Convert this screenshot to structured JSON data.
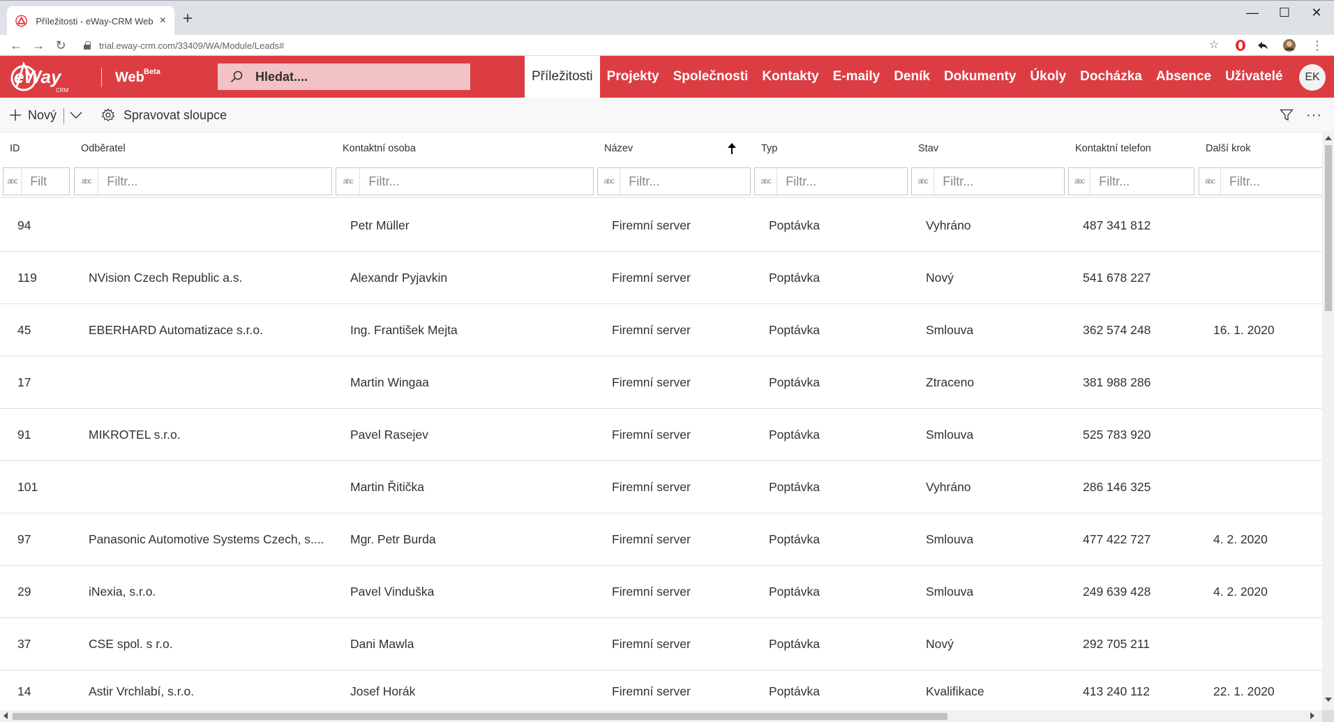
{
  "browser": {
    "tab_title": "Příležitosti - eWay-CRM Web Access",
    "tab_close": "×",
    "new_tab": "+",
    "url": "trial.eway-crm.com/33409/WA/Module/Leads#",
    "minimize": "—",
    "maximize": "☐",
    "close": "✕"
  },
  "header": {
    "logo_text": "eWay",
    "logo_sub": "CRM",
    "web_label": "Web",
    "web_beta": "Beta",
    "search_placeholder": "Hledat....",
    "nav": [
      {
        "label": "Příležitosti",
        "active": true
      },
      {
        "label": "Projekty"
      },
      {
        "label": "Společnosti"
      },
      {
        "label": "Kontakty"
      },
      {
        "label": "E-maily"
      },
      {
        "label": "Deník"
      },
      {
        "label": "Dokumenty"
      },
      {
        "label": "Úkoly"
      },
      {
        "label": "Docházka"
      },
      {
        "label": "Absence"
      },
      {
        "label": "Uživatelé"
      }
    ],
    "user_initials": "EK",
    "brand_color": "#dc3d43"
  },
  "commands": {
    "new_label": "Nový",
    "manage_columns_label": "Spravovat sloupce"
  },
  "grid": {
    "columns": [
      "ID",
      "Odběratel",
      "Kontaktní osoba",
      "Název",
      "Typ",
      "Stav",
      "Kontaktní telefon",
      "Další krok"
    ],
    "filter_placeholder_short": "Filt",
    "filter_placeholder": "Filtr...",
    "filter_type_glyph": "abc",
    "rows": [
      {
        "id": "94",
        "customer": "",
        "contact": "Petr Müller",
        "name": "Firemní server",
        "type": "Poptávka",
        "state": "Vyhráno",
        "phone": "487 341 812",
        "next": ""
      },
      {
        "id": "119",
        "customer": "NVision Czech Republic a.s.",
        "contact": "Alexandr Pyjavkin",
        "name": "Firemní server",
        "type": "Poptávka",
        "state": "Nový",
        "phone": "541 678 227",
        "next": ""
      },
      {
        "id": "45",
        "customer": "EBERHARD Automatizace s.r.o.",
        "contact": "Ing. František Mejta",
        "name": "Firemní server",
        "type": "Poptávka",
        "state": "Smlouva",
        "phone": "362 574 248",
        "next": "16. 1. 2020"
      },
      {
        "id": "17",
        "customer": "",
        "contact": "Martin Wingaa",
        "name": "Firemní server",
        "type": "Poptávka",
        "state": "Ztraceno",
        "phone": "381 988 286",
        "next": ""
      },
      {
        "id": "91",
        "customer": "MIKROTEL s.r.o.",
        "contact": "Pavel Rasejev",
        "name": "Firemní server",
        "type": "Poptávka",
        "state": "Smlouva",
        "phone": "525 783 920",
        "next": ""
      },
      {
        "id": "101",
        "customer": "",
        "contact": "Martin Řitička",
        "name": "Firemní server",
        "type": "Poptávka",
        "state": "Vyhráno",
        "phone": "286 146 325",
        "next": ""
      },
      {
        "id": "97",
        "customer": "Panasonic Automotive Systems Czech, s....",
        "contact": "Mgr. Petr Burda",
        "name": "Firemní server",
        "type": "Poptávka",
        "state": "Smlouva",
        "phone": "477 422 727",
        "next": "4. 2. 2020"
      },
      {
        "id": "29",
        "customer": "iNexia, s.r.o.",
        "contact": "Pavel Vinduška",
        "name": "Firemní server",
        "type": "Poptávka",
        "state": "Smlouva",
        "phone": "249 639 428",
        "next": "4. 2. 2020"
      },
      {
        "id": "37",
        "customer": "CSE spol. s r.o.",
        "contact": "Dani Mawla",
        "name": "Firemní server",
        "type": "Poptávka",
        "state": "Nový",
        "phone": "292 705 211",
        "next": ""
      },
      {
        "id": "14",
        "customer": "Astir Vrchlabí, s.r.o.",
        "contact": "Josef Horák",
        "name": "Firemní server",
        "type": "Poptávka",
        "state": "Kvalifikace",
        "phone": "413 240 112",
        "next": "22. 1. 2020"
      }
    ]
  }
}
